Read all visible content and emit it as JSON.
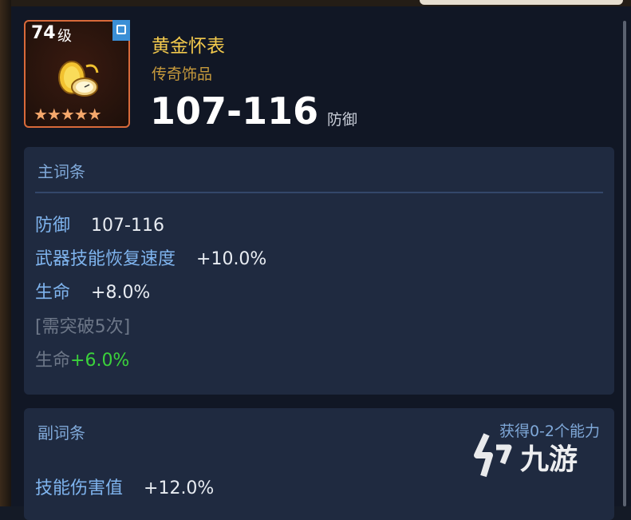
{
  "item": {
    "level_number": "74",
    "level_unit": "级",
    "stars": "★★★★★",
    "name": "黄金怀表",
    "rarity": "传奇饰品",
    "stat_value": "107-116",
    "stat_unit": "防御"
  },
  "main_section": {
    "title": "主词条",
    "lines": [
      {
        "label": "防御",
        "value": "107-116"
      },
      {
        "label": "武器技能恢复速度",
        "value": "+10.0%"
      },
      {
        "label": "生命",
        "value": "+8.0%"
      }
    ],
    "locked_note": "[需突破5次]",
    "locked_label": "生命",
    "locked_value": "+6.0%"
  },
  "sub_section": {
    "title": "副词条",
    "hint": "获得0-2个能力",
    "lines": [
      {
        "label": "技能伤害值",
        "value": "+12.0%"
      }
    ]
  },
  "watermark": {
    "text": "九游"
  },
  "colors": {
    "gold_name": "#f2c94c",
    "stat_label_blue": "#7fb4ee",
    "bonus_green": "#3bd23b",
    "section_bg": "#1f2a40"
  }
}
